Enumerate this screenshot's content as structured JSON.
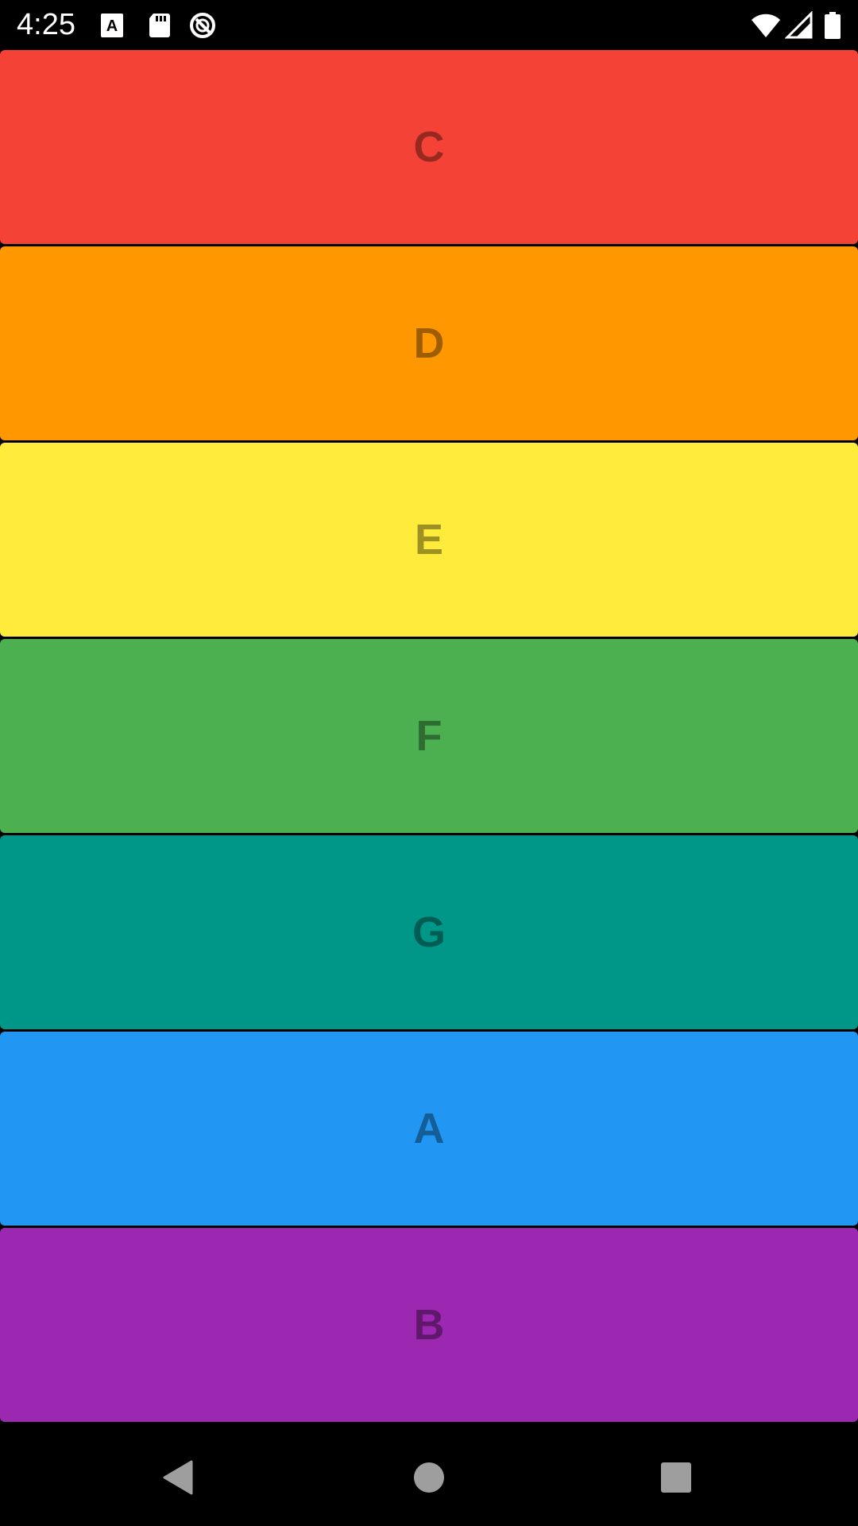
{
  "status_bar": {
    "time": "4:25",
    "icons": [
      "font-a-icon",
      "sd-card-icon",
      "no-disturb-icon",
      "wifi-icon",
      "signal-icon",
      "battery-icon"
    ]
  },
  "cards": [
    {
      "letter": "C",
      "color": "#F44336"
    },
    {
      "letter": "D",
      "color": "#FF9800"
    },
    {
      "letter": "E",
      "color": "#FFEB3B"
    },
    {
      "letter": "F",
      "color": "#4CAF50"
    },
    {
      "letter": "G",
      "color": "#009688"
    },
    {
      "letter": "A",
      "color": "#2196F3"
    },
    {
      "letter": "B",
      "color": "#9C27B0"
    }
  ],
  "nav_bar": {
    "buttons": [
      "back-icon",
      "home-icon",
      "recents-icon"
    ]
  }
}
